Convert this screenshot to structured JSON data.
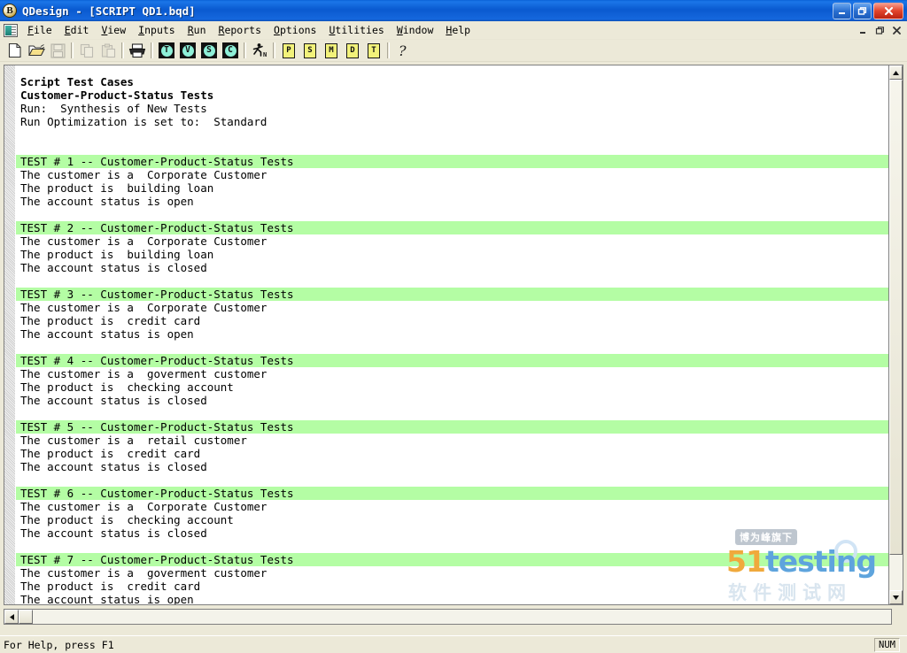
{
  "window": {
    "title": "QDesign - [SCRIPT QD1.bqd]",
    "logo_letter": "B",
    "controls": {
      "minimize": "minimize-icon",
      "maximize": "maximize-icon",
      "close": "close-icon"
    }
  },
  "menubar": {
    "items": [
      {
        "label": "File",
        "accel": "F"
      },
      {
        "label": "Edit",
        "accel": "E"
      },
      {
        "label": "View",
        "accel": "V"
      },
      {
        "label": "Inputs",
        "accel": "I"
      },
      {
        "label": "Run",
        "accel": "R"
      },
      {
        "label": "Reports",
        "accel": "R"
      },
      {
        "label": "Options",
        "accel": "O"
      },
      {
        "label": "Utilities",
        "accel": "U"
      },
      {
        "label": "Window",
        "accel": "W"
      },
      {
        "label": "Help",
        "accel": "H"
      }
    ],
    "mdi_controls": [
      "minimize-icon",
      "restore-icon",
      "close-icon"
    ]
  },
  "toolbar": {
    "buttons": [
      {
        "name": "new-icon",
        "kind": "page-blank",
        "label": "",
        "enabled": true
      },
      {
        "name": "open-icon",
        "kind": "folder-open",
        "label": "",
        "enabled": true
      },
      {
        "name": "save-icon",
        "kind": "floppy",
        "label": "",
        "enabled": false
      },
      {
        "name": "copy-icon",
        "kind": "copy",
        "label": "",
        "enabled": false
      },
      {
        "name": "paste-icon",
        "kind": "paste",
        "label": "",
        "enabled": false
      },
      {
        "name": "print-icon",
        "kind": "printer",
        "label": "",
        "enabled": true
      },
      {
        "name": "tests-icon",
        "kind": "circle-cyan",
        "label": "T",
        "enabled": true
      },
      {
        "name": "verify-icon",
        "kind": "circle-cyan",
        "label": "V",
        "enabled": true
      },
      {
        "name": "script-icon",
        "kind": "circle-cyan",
        "label": "S",
        "enabled": true
      },
      {
        "name": "coverage-icon",
        "kind": "circle-cyan",
        "label": "C",
        "enabled": true
      },
      {
        "name": "run-new-icon",
        "kind": "runner",
        "label": "N",
        "enabled": true
      },
      {
        "name": "report-p-icon",
        "kind": "page-yellow",
        "label": "P",
        "enabled": true
      },
      {
        "name": "report-s-icon",
        "kind": "page-yellow",
        "label": "S",
        "enabled": true
      },
      {
        "name": "report-m-icon",
        "kind": "page-yellow",
        "label": "M",
        "enabled": true
      },
      {
        "name": "report-d-icon",
        "kind": "page-yellow",
        "label": "D",
        "enabled": true
      },
      {
        "name": "report-t-icon",
        "kind": "page-yellow",
        "label": "T",
        "enabled": true
      },
      {
        "name": "help-icon",
        "kind": "help",
        "label": "",
        "enabled": true
      }
    ]
  },
  "document": {
    "header": [
      {
        "text": "Script Test Cases",
        "bold": true
      },
      {
        "text": "Customer-Product-Status Tests",
        "bold": true
      },
      {
        "text": "Run:  Synthesis of New Tests",
        "bold": false
      },
      {
        "text": "Run Optimization is set to:  Standard",
        "bold": false
      }
    ],
    "tests": [
      {
        "header": "TEST # 1 -- Customer-Product-Status Tests",
        "lines": [
          "The customer is a  Corporate Customer",
          "The product is  building loan",
          "The account status is open"
        ]
      },
      {
        "header": "TEST # 2 -- Customer-Product-Status Tests",
        "lines": [
          "The customer is a  Corporate Customer",
          "The product is  building loan",
          "The account status is closed"
        ]
      },
      {
        "header": "TEST # 3 -- Customer-Product-Status Tests",
        "lines": [
          "The customer is a  Corporate Customer",
          "The product is  credit card",
          "The account status is open"
        ]
      },
      {
        "header": "TEST # 4 -- Customer-Product-Status Tests",
        "lines": [
          "The customer is a  goverment customer",
          "The product is  checking account",
          "The account status is closed"
        ]
      },
      {
        "header": "TEST # 5 -- Customer-Product-Status Tests",
        "lines": [
          "The customer is a  retail customer",
          "The product is  credit card",
          "The account status is closed"
        ]
      },
      {
        "header": "TEST # 6 -- Customer-Product-Status Tests",
        "lines": [
          "The customer is a  Corporate Customer",
          "The product is  checking account",
          "The account status is closed"
        ]
      },
      {
        "header": "TEST # 7 -- Customer-Product-Status Tests",
        "lines": [
          "The customer is a  goverment customer",
          "The product is  credit card",
          "The account status is open"
        ]
      }
    ]
  },
  "statusbar": {
    "help_text": "For Help, press F1",
    "num_indicator": "NUM"
  },
  "watermark": {
    "badge": "博为峰旗下",
    "brand_51": "51",
    "brand_testing": "testing",
    "subtitle": "软件测试网"
  },
  "colors": {
    "title_blue": "#0a5ad0",
    "test_highlight_green": "#b4fda4",
    "chrome": "#ece9d8",
    "toolbar_cyan": "#8ef0d8",
    "toolbar_yellow": "#f2f27a"
  }
}
